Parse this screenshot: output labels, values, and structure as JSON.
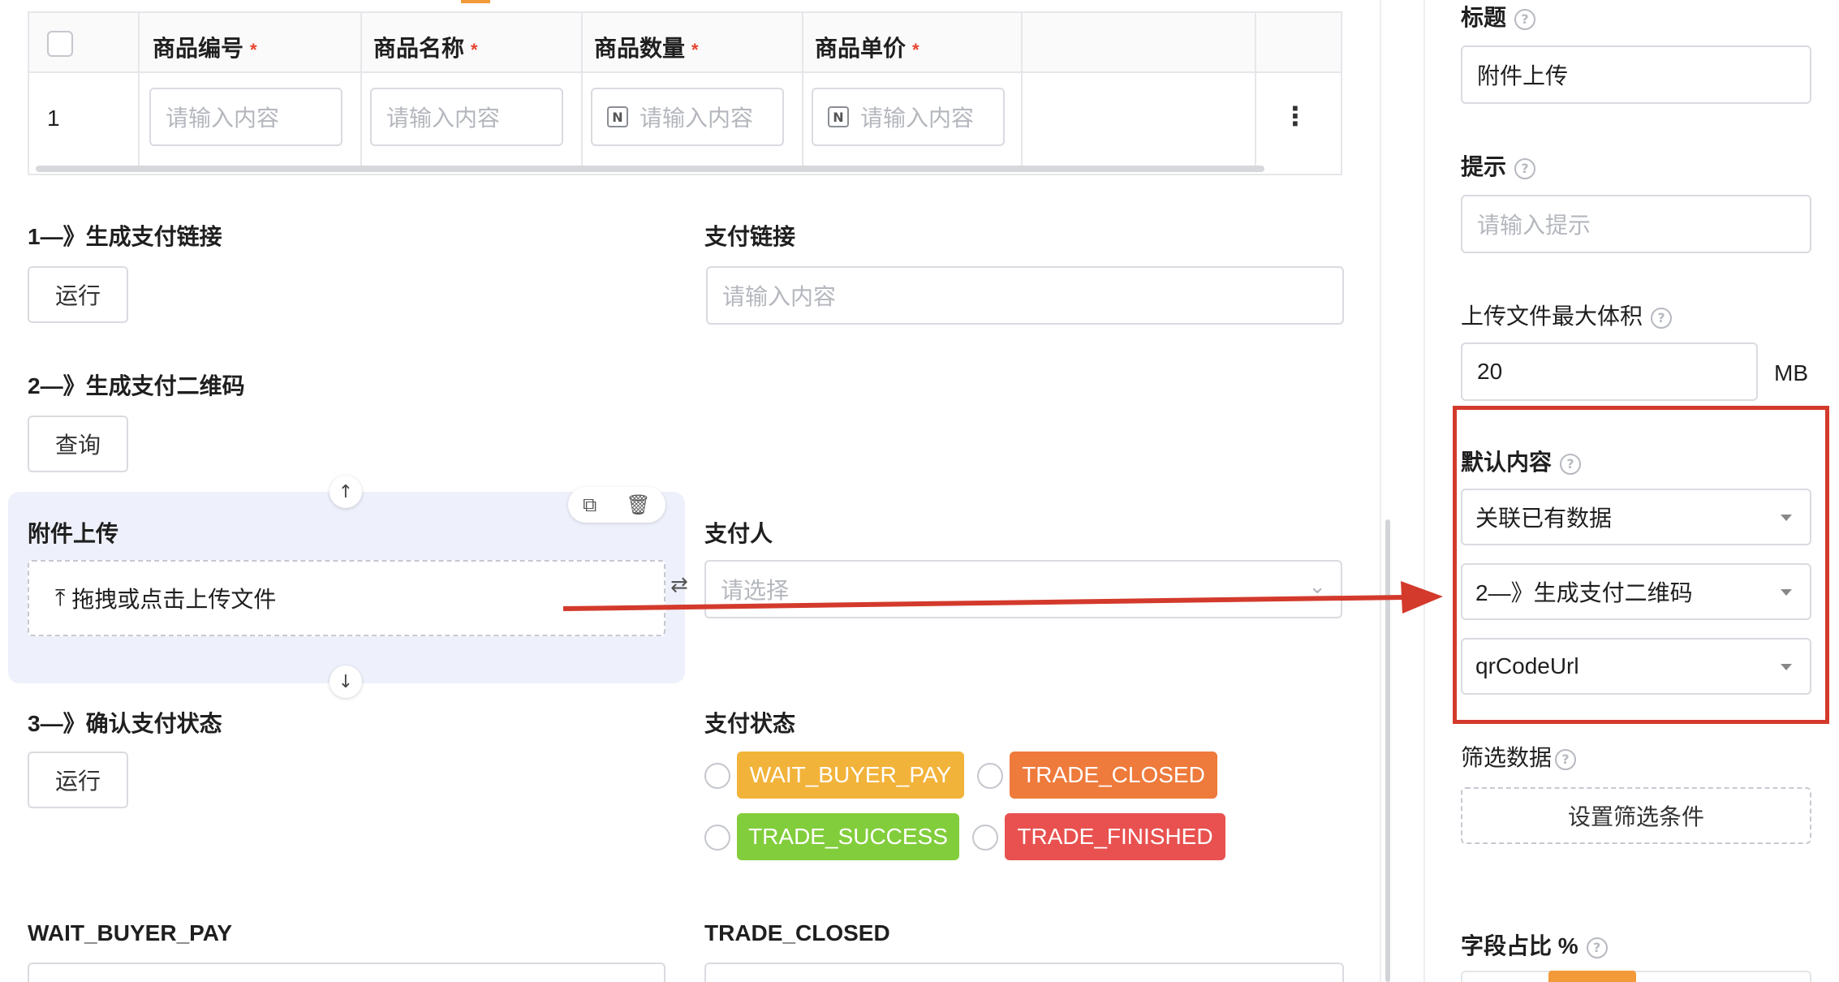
{
  "table": {
    "headers": [
      "商品编号",
      "商品名称",
      "商品数量",
      "商品单价"
    ],
    "row_index": "1",
    "placeholders": [
      "请输入内容",
      "请输入内容",
      "请输入内容",
      "请输入内容"
    ],
    "more": "⋮"
  },
  "fields": {
    "gen_link_label": "1—》生成支付链接",
    "gen_link_btn": "运行",
    "pay_link_label": "支付链接",
    "pay_link_placeholder": "请输入内容",
    "gen_qr_label": "2—》生成支付二维码",
    "gen_qr_btn": "查询",
    "upload_label": "附件上传",
    "upload_text": "拖拽或点击上传文件",
    "payer_label": "支付人",
    "payer_placeholder": "请选择",
    "confirm_label": "3—》确认支付状态",
    "confirm_btn": "运行",
    "status_label": "支付状态",
    "wait_label": "WAIT_BUYER_PAY",
    "closed_label": "TRADE_CLOSED"
  },
  "status_tags": [
    {
      "text": "WAIT_BUYER_PAY",
      "color": "#f2b33a"
    },
    {
      "text": "TRADE_CLOSED",
      "color": "#ee7a3b"
    },
    {
      "text": "TRADE_SUCCESS",
      "color": "#82cd3c"
    },
    {
      "text": "TRADE_FINISHED",
      "color": "#e8514f"
    }
  ],
  "panel": {
    "title_label": "标题",
    "title_value": "附件上传",
    "hint_label": "提示",
    "hint_placeholder": "请输入提示",
    "max_size_label": "上传文件最大体积",
    "max_size_value": "20",
    "max_size_unit": "MB",
    "default_label": "默认内容",
    "default_select_1": "关联已有数据",
    "default_select_2": "2—》生成支付二维码",
    "default_select_3": "qrCodeUrl",
    "filter_label": "筛选数据",
    "filter_btn": "设置筛选条件",
    "width_label": "字段占比 %"
  },
  "colors": {
    "highlight": "#d33a2c",
    "accent": "#f29a3a",
    "selected_bg": "#eef0fb"
  },
  "icons": [
    "help-icon",
    "upload-icon",
    "copy-icon",
    "delete-icon",
    "arrow-up-icon",
    "arrow-down-icon",
    "swap-icon",
    "number-icon",
    "chevron-down-icon",
    "more-icon"
  ]
}
